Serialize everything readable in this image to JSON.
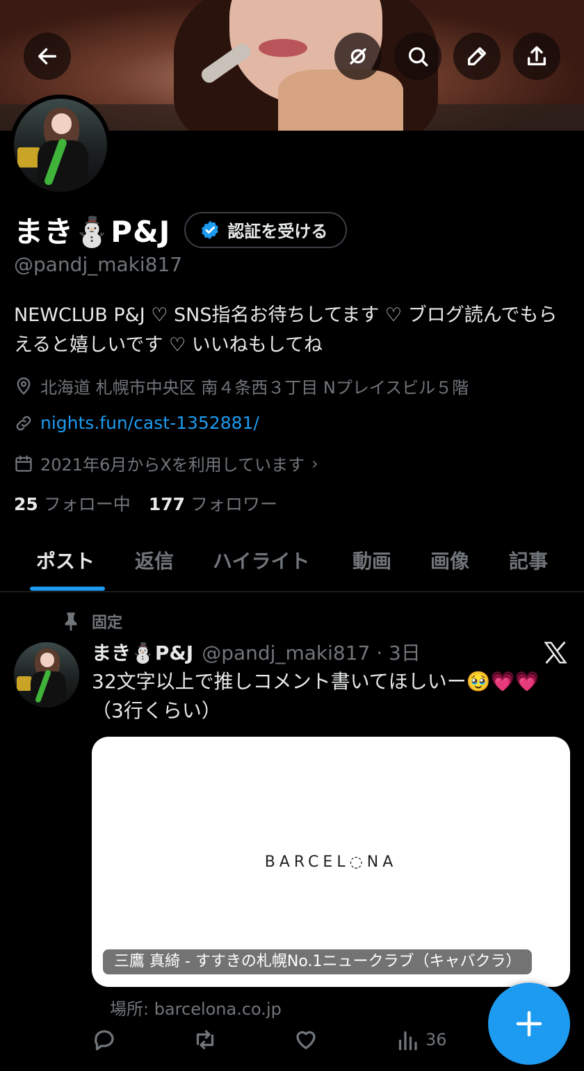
{
  "profile": {
    "display_name": "まき⛄️P&J",
    "verify_label": "認証を受ける",
    "handle": "@pandj_maki817",
    "bio": "NEWCLUB P&J ♡ SNS指名お待ちしてます ♡ ブログ読んでもらえると嬉しいです ♡ いいねもしてね",
    "location": "北海道 札幌市中央区 南４条西３丁目 Nプレイスビル５階",
    "link": "nights.fun/cast-1352881/",
    "joined": "2021年6月からXを利用しています",
    "following_count": "25",
    "following_label": "フォロー中",
    "followers_count": "177",
    "followers_label": "フォロワー"
  },
  "tabs": [
    "ポスト",
    "返信",
    "ハイライト",
    "動画",
    "画像",
    "記事"
  ],
  "pinned_label": "固定",
  "tweet": {
    "name": "まき⛄️P&J",
    "meta": "@pandj_maki817 · 3日",
    "text": "32文字以上で推しコメント書いてほしいー🥹💗💗（3行くらい）",
    "card_logo": "BARCEL◌NA",
    "card_title": "三鷹 真綺 - すすきの札幌No.1ニュークラブ（キャバクラ）",
    "card_source": "場所: barcelona.co.jp",
    "views": "36"
  },
  "icons": {
    "back": "arrow-left-icon",
    "mute": "eye-slash-icon",
    "search": "search-icon",
    "edit": "pencil-icon",
    "share": "share-icon",
    "compose": "plus-icon"
  },
  "colors": {
    "accent": "#1d9bf0",
    "background": "#000000",
    "muted": "#71767b"
  }
}
